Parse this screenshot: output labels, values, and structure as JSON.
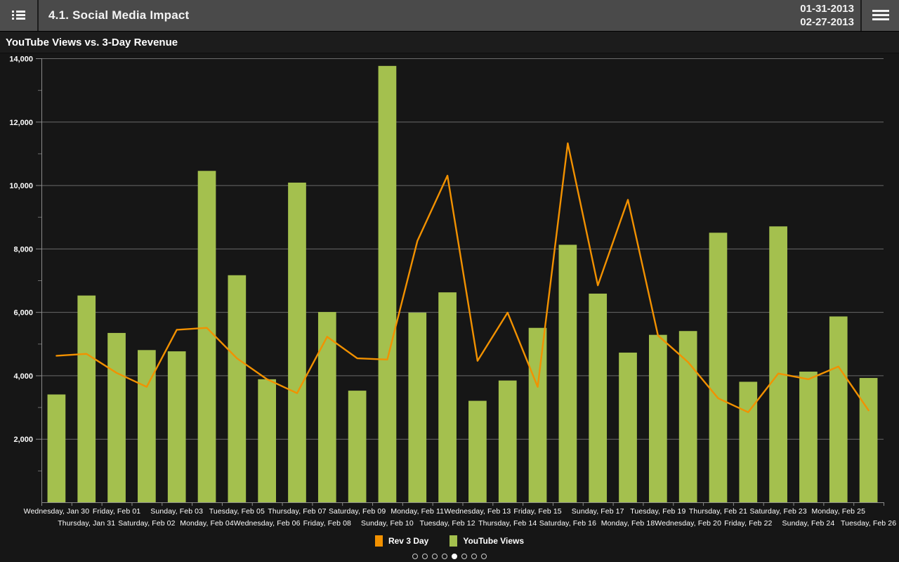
{
  "topbar": {
    "menu_icon": "list-icon",
    "title": "4.1. Social Media Impact",
    "date_start": "01-31-2013",
    "date_end": "02-27-2013",
    "options_icon": "hamburger-icon"
  },
  "chart_title": "YouTube Views vs. 3-Day Revenue",
  "legend": [
    {
      "label": "Rev 3 Day",
      "color": "#f29100",
      "swatch": "orange-square"
    },
    {
      "label": "YouTube Views",
      "color": "#a4c04e",
      "swatch": "green-square"
    }
  ],
  "pager": {
    "total": 8,
    "active_index": 4
  },
  "colors": {
    "bar": "#a4c04e",
    "line": "#f29100",
    "plot_background": "#161616",
    "gridline": "#6a6a6a",
    "axis_text": "#ffffff",
    "header_background": "#4a4a4a",
    "title_background": "#1c1c1c"
  },
  "chart_data": {
    "type": "bar",
    "title": "YouTube Views vs. 3-Day Revenue",
    "xlabel": "",
    "ylabel": "",
    "ylim": [
      0,
      14000
    ],
    "yticks": [
      2000,
      4000,
      6000,
      8000,
      10000,
      12000,
      14000
    ],
    "ytick_labels": [
      "2,000",
      "4,000",
      "6,000",
      "8,000",
      "10,000",
      "12,000",
      "14,000"
    ],
    "minor_yticks": [
      1000,
      3000,
      5000,
      7000,
      9000,
      11000,
      13000
    ],
    "grid": true,
    "legend_position": "bottom",
    "categories": [
      "Wednesday, Jan 30",
      "Thursday, Jan 31",
      "Friday, Feb 01",
      "Saturday, Feb 02",
      "Sunday, Feb 03",
      "Monday, Feb 04",
      "Tuesday, Feb 05",
      "Wednesday, Feb 06",
      "Thursday, Feb 07",
      "Friday, Feb 08",
      "Saturday, Feb 09",
      "Sunday, Feb 10",
      "Monday, Feb 11",
      "Tuesday, Feb 12",
      "Wednesday, Feb 13",
      "Thursday, Feb 14",
      "Friday, Feb 15",
      "Saturday, Feb 16",
      "Sunday, Feb 17",
      "Monday, Feb 18",
      "Tuesday, Feb 19",
      "Wednesday, Feb 20",
      "Thursday, Feb 21",
      "Friday, Feb 22",
      "Saturday, Feb 23",
      "Sunday, Feb 24",
      "Monday, Feb 25",
      "Tuesday, Feb 26"
    ],
    "series": [
      {
        "name": "YouTube Views",
        "type": "bar",
        "color": "#a4c04e",
        "values": [
          3400,
          6520,
          5340,
          4800,
          4760,
          10450,
          7160,
          3880,
          10080,
          6000,
          3520,
          13760,
          5980,
          6620,
          3200,
          3840,
          5500,
          8120,
          6580,
          4720,
          5280,
          5400,
          8500,
          3800,
          8700,
          4120,
          5860,
          3920
        ]
      },
      {
        "name": "Rev 3 Day",
        "type": "line",
        "color": "#f29100",
        "values": [
          4620,
          4680,
          4080,
          3640,
          5440,
          5500,
          4540,
          3880,
          3440,
          5220,
          4540,
          4500,
          8240,
          10300,
          4460,
          5980,
          3640,
          11320,
          6840,
          9540,
          5260,
          4420,
          3280,
          2840,
          4060,
          3880,
          4280,
          2900
        ]
      }
    ]
  }
}
